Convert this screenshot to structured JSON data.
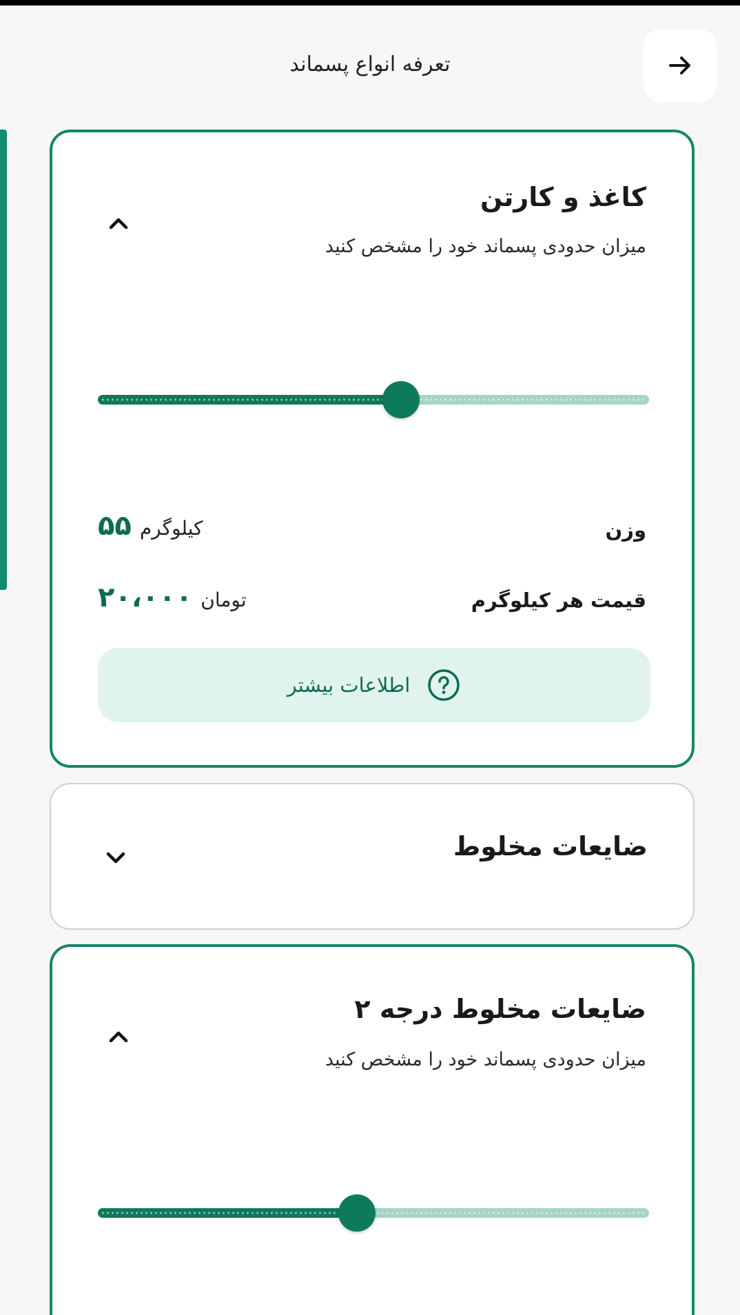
{
  "header": {
    "title": "تعرفه انواع پسماند",
    "back_icon": "arrow-right-icon"
  },
  "colors": {
    "accent": "#14866a",
    "accent_dark": "#0e7a5c",
    "accent_light": "#e1f3ee",
    "track_light": "#a6d4c6"
  },
  "cards": [
    {
      "title": "کاغذ و کارتن",
      "subtitle": "میزان حدودی پسماند خود را مشخص کنید",
      "expanded": true,
      "slider_fraction": 0.55,
      "weight_label": "وزن",
      "weight_value": "۵۵",
      "weight_unit": "کیلوگرم",
      "price_label": "قیمت هر کیلوگرم",
      "price_value": "۲۰،۰۰۰",
      "price_unit": "تومان",
      "more_label": "اطلاعات بیشتر",
      "more_icon": "question-circle-icon"
    },
    {
      "title": "ضایعات مخلوط",
      "expanded": false
    },
    {
      "title": "ضایعات مخلوط درجه ۲",
      "subtitle": "میزان حدودی پسماند خود را مشخص کنید",
      "expanded": true,
      "slider_fraction": 0.47
    }
  ]
}
